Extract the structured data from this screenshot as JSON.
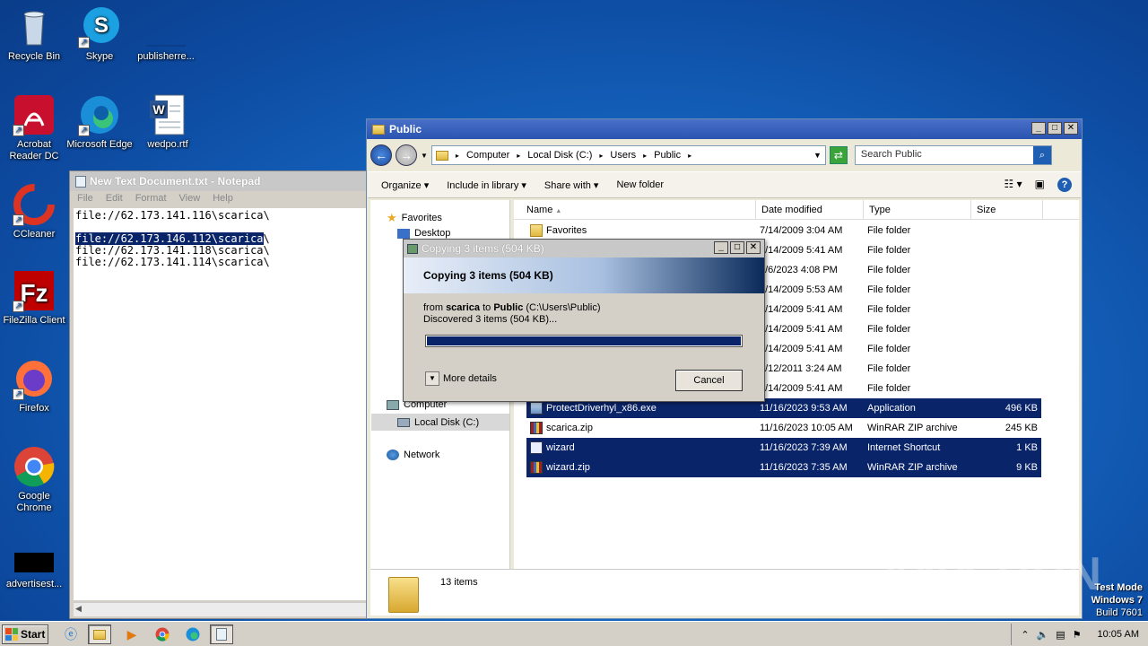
{
  "desktop": {
    "icons": [
      {
        "label": "Recycle Bin"
      },
      {
        "label": "Skype"
      },
      {
        "label": "publisherre..."
      },
      {
        "label": "Acrobat Reader DC"
      },
      {
        "label": "Microsoft Edge"
      },
      {
        "label": "wedpo.rtf"
      },
      {
        "label": "CCleaner"
      },
      {
        "label": "FileZilla Client"
      },
      {
        "label": "Firefox"
      },
      {
        "label": "Google Chrome"
      },
      {
        "label": "advertisest..."
      }
    ]
  },
  "notepad": {
    "title": "New Text Document.txt - Notepad",
    "menu": [
      "File",
      "Edit",
      "Format",
      "View",
      "Help"
    ],
    "lines": [
      "file://62.173.141.116\\scarica\\",
      "",
      "file://62.173.146.112\\scarica",
      "file://62.173.141.118\\scarica\\",
      "file://62.173.141.114\\scarica\\"
    ],
    "selected_trailing": "\\"
  },
  "explorer": {
    "title": "Public",
    "breadcrumb": [
      "Computer",
      "Local Disk (C:)",
      "Users",
      "Public"
    ],
    "search_placeholder": "Search Public",
    "toolbar": [
      "Organize",
      "Include in library",
      "Share with",
      "New folder"
    ],
    "nav": {
      "favorites": "Favorites",
      "desktop": "Desktop",
      "computer": "Computer",
      "local_disk": "Local Disk (C:)",
      "network": "Network"
    },
    "columns": [
      "Name",
      "Date modified",
      "Type",
      "Size"
    ],
    "rows": [
      {
        "name": "Favorites",
        "date": "7/14/2009 3:04 AM",
        "type": "File folder",
        "size": ""
      },
      {
        "name": "",
        "date": "7/14/2009 5:41 AM",
        "type": "File folder",
        "size": ""
      },
      {
        "name": "",
        "date": "1/6/2023 4:08 PM",
        "type": "File folder",
        "size": ""
      },
      {
        "name": "",
        "date": "7/14/2009 5:53 AM",
        "type": "File folder",
        "size": ""
      },
      {
        "name": "",
        "date": "7/14/2009 5:41 AM",
        "type": "File folder",
        "size": ""
      },
      {
        "name": "",
        "date": "7/14/2009 5:41 AM",
        "type": "File folder",
        "size": ""
      },
      {
        "name": "",
        "date": "7/14/2009 5:41 AM",
        "type": "File folder",
        "size": ""
      },
      {
        "name": "",
        "date": "4/12/2011 3:24 AM",
        "type": "File folder",
        "size": ""
      },
      {
        "name": "",
        "date": "7/14/2009 5:41 AM",
        "type": "File folder",
        "size": ""
      },
      {
        "name": "ProtectDriverhyl_x86.exe",
        "date": "11/16/2023 9:53 AM",
        "type": "Application",
        "size": "496 KB"
      },
      {
        "name": "scarica.zip",
        "date": "11/16/2023 10:05 AM",
        "type": "WinRAR ZIP archive",
        "size": "245 KB"
      },
      {
        "name": "wizard",
        "date": "11/16/2023 7:39 AM",
        "type": "Internet Shortcut",
        "size": "1 KB"
      },
      {
        "name": "wizard.zip",
        "date": "11/16/2023 7:35 AM",
        "type": "WinRAR ZIP archive",
        "size": "9 KB"
      }
    ],
    "status": "13 items"
  },
  "copy_dialog": {
    "title": "Copying 3 items (504 KB)",
    "heading": "Copying 3 items (504 KB)",
    "from_prefix": "from",
    "from_src": "scarica",
    "from_to": "to",
    "from_dst": "Public",
    "from_path": "(C:\\Users\\Public)",
    "discovered": "Discovered 3 items (504 KB)...",
    "progress": 1.0,
    "more_details": "More details",
    "cancel": "Cancel"
  },
  "taskbar": {
    "start": "Start",
    "clock": "10:05 AM"
  },
  "watermark": "ANY RUN",
  "testmode": [
    "Test Mode",
    "Windows 7",
    "Build 7601"
  ]
}
